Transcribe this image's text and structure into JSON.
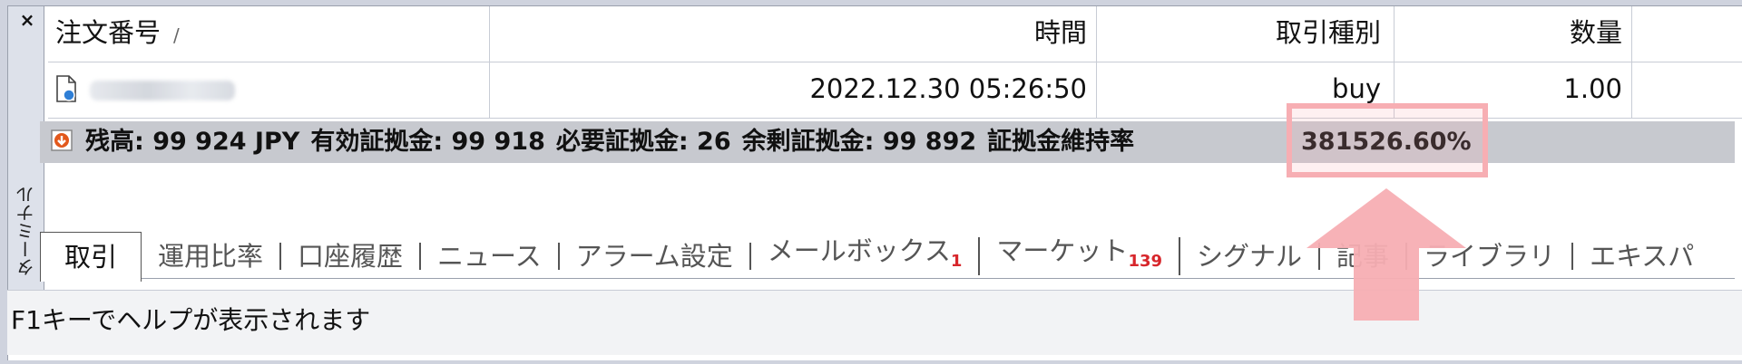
{
  "panel": {
    "close_glyph": "×",
    "vertical_label": "ターミナル"
  },
  "table": {
    "headers": {
      "order": "注文番号",
      "sort_glyph": "/",
      "time": "時間",
      "type": "取引種別",
      "qty": "数量"
    },
    "rows": [
      {
        "order": "",
        "time": "2022.12.30 05:26:50",
        "type": "buy",
        "qty": "1.00"
      }
    ]
  },
  "balance": {
    "balance": "残高: 99 924 JPY",
    "equity": "有効証拠金: 99 918",
    "margin": "必要証拠金: 26",
    "free_margin": "余剰証拠金: 99 892",
    "margin_level_label": "証拠金維持率",
    "margin_level_value": "381526.60%"
  },
  "tabs": [
    {
      "label": "取引",
      "active": true
    },
    {
      "label": "運用比率"
    },
    {
      "label": "口座履歴"
    },
    {
      "label": "ニュース"
    },
    {
      "label": "アラーム設定"
    },
    {
      "label": "メールボックス",
      "badge": "1"
    },
    {
      "label": "マーケット",
      "badge": "139"
    },
    {
      "label": "シグナル"
    },
    {
      "label": "記事"
    },
    {
      "label": "ライブラリ"
    },
    {
      "label": "エキスパ"
    }
  ],
  "statusbar": {
    "text": "F1キーでヘルプが表示されます"
  },
  "colors": {
    "highlight": "#f7aeb3",
    "badge": "#d7262b",
    "balance_row_bg": "#c7c9cf"
  }
}
